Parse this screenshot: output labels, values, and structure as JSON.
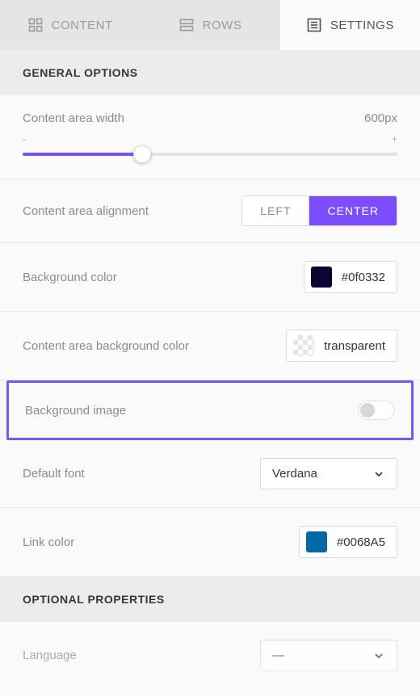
{
  "tabs": {
    "content": "CONTENT",
    "rows": "ROWS",
    "settings": "SETTINGS"
  },
  "sections": {
    "general": "GENERAL OPTIONS",
    "optional": "OPTIONAL PROPERTIES"
  },
  "general": {
    "content_width": {
      "label": "Content area width",
      "value": "600px",
      "minus": "-",
      "plus": "+"
    },
    "alignment": {
      "label": "Content area alignment",
      "left": "LEFT",
      "center": "CENTER"
    },
    "bg_color": {
      "label": "Background color",
      "value": "#0f0332",
      "swatch": "#0f0332"
    },
    "content_bg": {
      "label": "Content area background color",
      "value": "transparent"
    },
    "bg_image": {
      "label": "Background image"
    },
    "default_font": {
      "label": "Default font",
      "value": "Verdana"
    },
    "link_color": {
      "label": "Link color",
      "value": "#0068A5",
      "swatch": "#0068A5"
    }
  },
  "optional": {
    "language": {
      "label": "Language",
      "value": "—"
    }
  }
}
